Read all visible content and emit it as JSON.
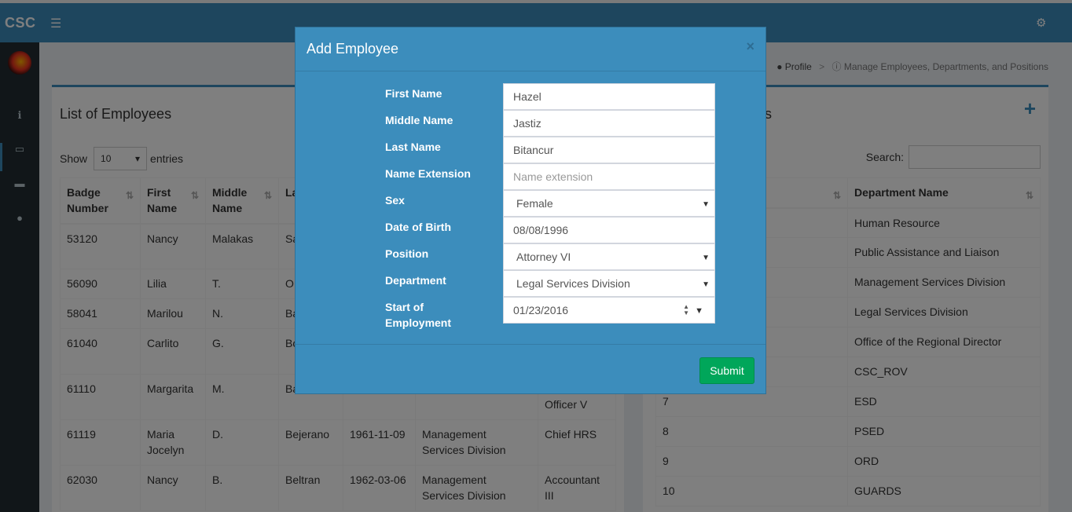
{
  "header": {
    "logo": "CSC",
    "menu_icon": "bars-icon",
    "settings_icon": "gears-icon"
  },
  "sidebar": {
    "icons": [
      "info-icon",
      "desktop-icon",
      "credit-card-icon",
      "user-icon"
    ]
  },
  "breadcrumb": {
    "profile": "Profile",
    "current": "Manage Employees, Departments, and Positions"
  },
  "employees": {
    "title": "List of Employees",
    "show_label": "Show",
    "entries_label": "entries",
    "page_length": "10",
    "columns": [
      "Badge Number",
      "First Name",
      "Middle Name",
      "La N"
    ],
    "rows": [
      [
        "53120",
        "Nancy",
        "Malakas",
        "Sa",
        "",
        "",
        ""
      ],
      [
        "56090",
        "Lilia",
        "T.",
        "O",
        "",
        "",
        ""
      ],
      [
        "58041",
        "Marilou",
        "N.",
        "Ba",
        "",
        "",
        ""
      ],
      [
        "61040",
        "Carlito",
        "G.",
        "Bo",
        "",
        "",
        ""
      ],
      [
        "61110",
        "Margarita",
        "M.",
        "Ba",
        "",
        "",
        "Officer V"
      ],
      [
        "61119",
        "Maria Jocelyn",
        "D.",
        "Bejerano",
        "1961-11-09",
        "Management Services Division",
        "Chief HRS"
      ],
      [
        "62030",
        "Nancy",
        "B.",
        "Beltran",
        "1962-03-06",
        "Management Services Division",
        "Accountant III"
      ]
    ]
  },
  "departments": {
    "title_visible": "nts",
    "entries_visible": "es",
    "search_label": "Search:",
    "columns": [
      "",
      "Department Name"
    ],
    "rows": [
      [
        "",
        "Human Resource"
      ],
      [
        "",
        "Public Assistance and Liaison"
      ],
      [
        "",
        "Management Services Division"
      ],
      [
        "",
        "Legal Services Division"
      ],
      [
        "",
        "Office of the Regional Director"
      ],
      [
        "",
        "CSC_ROV"
      ],
      [
        "7",
        "ESD"
      ],
      [
        "8",
        "PSED"
      ],
      [
        "9",
        "ORD"
      ],
      [
        "10",
        "GUARDS"
      ]
    ]
  },
  "modal": {
    "title": "Add Employee",
    "close": "×",
    "fields": {
      "first_name": {
        "label": "First Name",
        "value": "Hazel"
      },
      "middle_name": {
        "label": "Middle Name",
        "value": "Jastiz"
      },
      "last_name": {
        "label": "Last Name",
        "value": "Bitancur"
      },
      "name_extension": {
        "label": "Name Extension",
        "value": "",
        "placeholder": "Name extension"
      },
      "sex": {
        "label": "Sex",
        "value": "Female"
      },
      "dob": {
        "label": "Date of Birth",
        "value": "08/08/1996"
      },
      "position": {
        "label": "Position",
        "value": "Attorney VI"
      },
      "department": {
        "label": "Department",
        "value": "Legal Services Division"
      },
      "start": {
        "label": "Start of Employment",
        "value": "01/23/2016"
      }
    },
    "submit": "Submit"
  }
}
